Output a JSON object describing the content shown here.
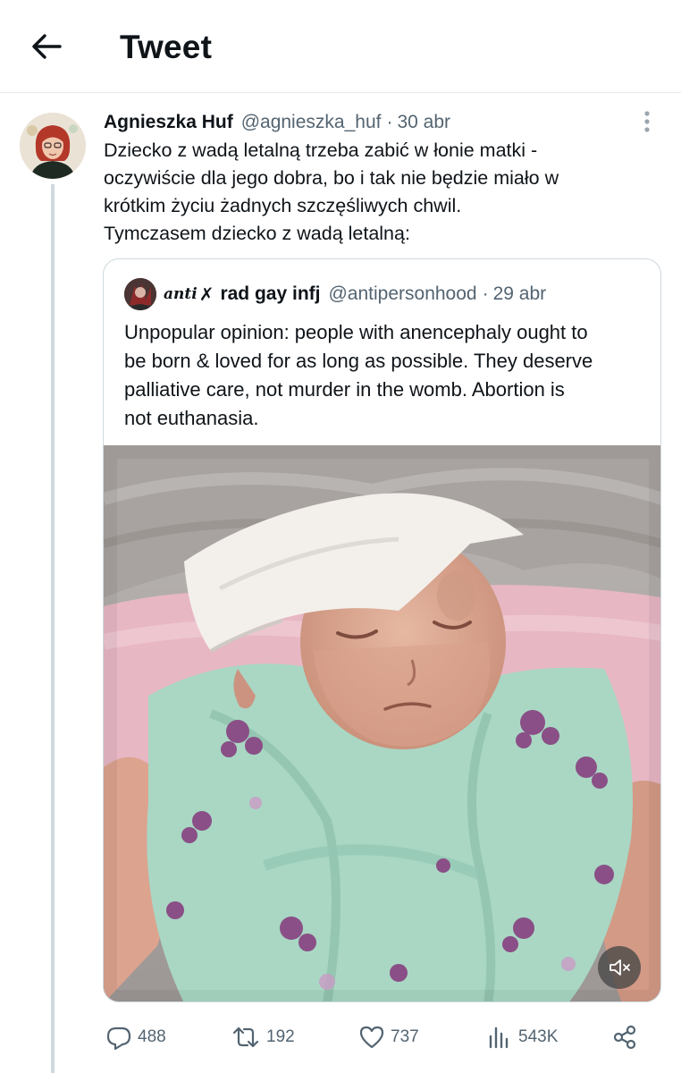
{
  "header": {
    "title": "Tweet",
    "back_icon": "arrow-left-icon"
  },
  "tweet": {
    "author_name": "Agnieszka Huf",
    "handle": "@agnieszka_huf",
    "separator": "·",
    "date": "30 abr",
    "text_lines": [
      "Dziecko z wadą letalną trzeba zabić w łonie matki -",
      "oczywiście dla jego dobra, bo i tak nie będzie miało w",
      "krótkim życiu żadnych szczęśliwych chwil.",
      "Tymczasem dziecko z wadą letalną:"
    ],
    "more_icon": "more-vertical-icon"
  },
  "quote": {
    "badge": "anti",
    "badge_mark": "✗",
    "author_name": "rad gay infj",
    "handle": "@antipersonhood",
    "separator": "·",
    "date": "29 abr",
    "text_lines": [
      "Unpopular opinion: people with anencephaly ought to",
      "be born & loved for as long as possible. They deserve",
      "palliative care, not murder in the womb. Abortion is",
      "not euthanasia."
    ],
    "media_mute_icon": "volume-muted-icon"
  },
  "actions": {
    "replies": "488",
    "retweets": "192",
    "likes": "737",
    "views": "543K",
    "icons": [
      "reply-icon",
      "retweet-icon",
      "like-icon",
      "views-icon",
      "share-icon"
    ]
  },
  "colors": {
    "text_primary": "#0f1419",
    "text_secondary": "#536471",
    "border": "#cfd9de"
  }
}
